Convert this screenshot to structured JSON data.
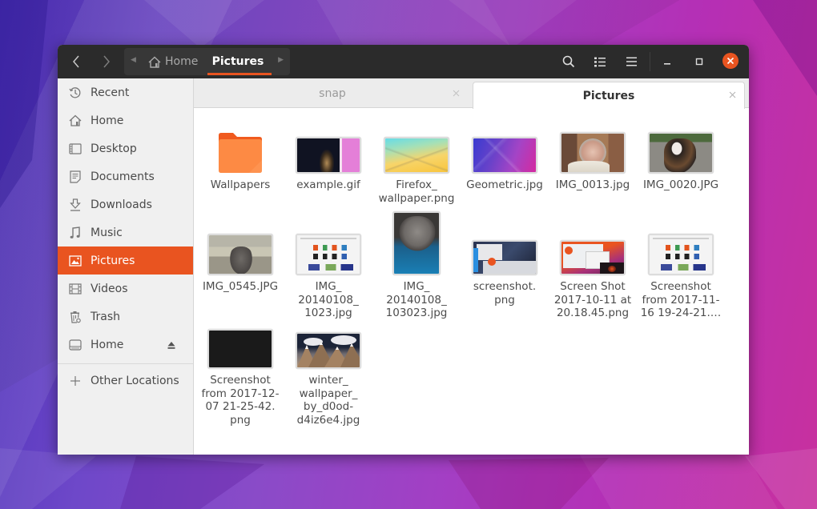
{
  "window": {
    "path": [
      {
        "label": "Home",
        "icon": "home-icon"
      },
      {
        "label": "Pictures",
        "active": true
      }
    ],
    "header_icons": [
      "search-icon",
      "view-list-icon",
      "menu-icon",
      "minimize-icon",
      "maximize-icon",
      "close-icon"
    ],
    "accent": "#e95420"
  },
  "sidebar": {
    "items": [
      {
        "label": "Recent",
        "icon": "clock-icon"
      },
      {
        "label": "Home",
        "icon": "home-icon"
      },
      {
        "label": "Desktop",
        "icon": "desktop-icon"
      },
      {
        "label": "Documents",
        "icon": "document-icon"
      },
      {
        "label": "Downloads",
        "icon": "download-icon"
      },
      {
        "label": "Music",
        "icon": "music-icon"
      },
      {
        "label": "Pictures",
        "icon": "picture-icon",
        "active": true
      },
      {
        "label": "Videos",
        "icon": "film-icon"
      },
      {
        "label": "Trash",
        "icon": "trash-icon"
      },
      {
        "label": "Home",
        "icon": "drive-icon",
        "eject": true
      }
    ],
    "other_locations": "Other Locations"
  },
  "tabs": [
    {
      "label": "snap",
      "active": false
    },
    {
      "label": "Pictures",
      "active": true
    }
  ],
  "files": [
    {
      "name": "Wallpapers",
      "type": "folder"
    },
    {
      "name": "example.gif",
      "type": "image"
    },
    {
      "name": "Firefox_\nwallpaper.png",
      "type": "image"
    },
    {
      "name": "Geometric.jpg",
      "type": "image"
    },
    {
      "name": "IMG_0013.jpg",
      "type": "image"
    },
    {
      "name": "IMG_0020.JPG",
      "type": "image"
    },
    {
      "name": "IMG_0545.JPG",
      "type": "image"
    },
    {
      "name": "IMG_\n20140108_\n1023.jpg",
      "type": "image"
    },
    {
      "name": "IMG_\n20140108_\n103023.jpg",
      "type": "image"
    },
    {
      "name": "screenshot.\npng",
      "type": "image"
    },
    {
      "name": "Screen Shot\n2017-10-11 at\n20.18.45.png",
      "type": "image"
    },
    {
      "name": "Screenshot\nfrom 2017-11-\n16 19-24-21.…",
      "type": "image"
    },
    {
      "name": "Screenshot\nfrom 2017-12-\n07 21-25-42.\npng",
      "type": "image"
    },
    {
      "name": "winter_\nwallpaper_\nby_d0od-\nd4iz6e4.jpg",
      "type": "image"
    }
  ]
}
